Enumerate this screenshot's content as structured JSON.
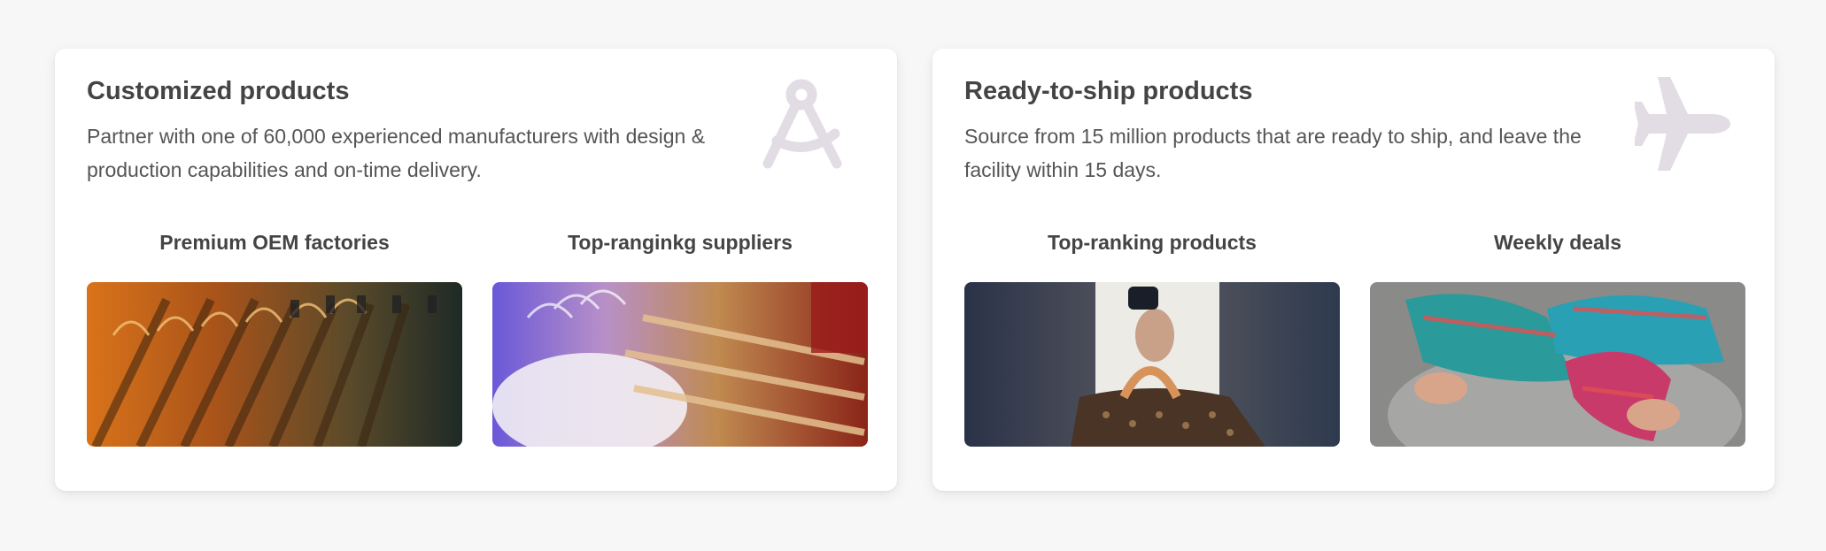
{
  "sections": [
    {
      "title": "Customized products",
      "description": "Partner with one of 60,000 experienced manufacturers with design & production capabilities and on-time delivery.",
      "icon": "compass-icon",
      "tiles": [
        {
          "label": "Premium OEM factories",
          "image": "hanging-shirts-image"
        },
        {
          "label": "Top-ranginkg suppliers",
          "image": "clothing-rack-image"
        }
      ]
    },
    {
      "title": "Ready-to-ship products",
      "description": "Source from 15 million products that are ready to ship, and leave the facility within 15 days.",
      "icon": "airplane-icon",
      "tiles": [
        {
          "label": "Top-ranking products",
          "image": "handbag-image"
        },
        {
          "label": "Weekly deals",
          "image": "knitted-gloves-image"
        }
      ]
    }
  ],
  "colors": {
    "title": "#444444",
    "text": "#555555",
    "icon": "#e2dce4",
    "card": "#ffffff",
    "background": "#f7f7f8"
  }
}
